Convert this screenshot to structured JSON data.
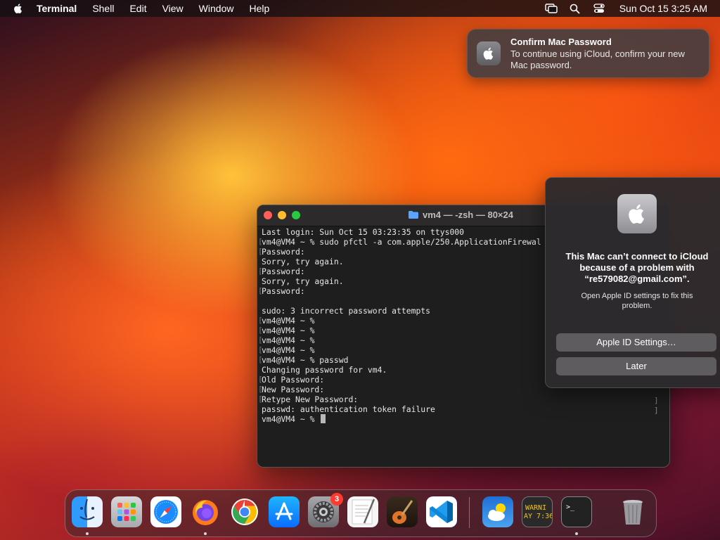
{
  "menubar": {
    "app_name": "Terminal",
    "items": [
      "Shell",
      "Edit",
      "View",
      "Window",
      "Help"
    ],
    "clock": "Sun Oct 15  3:25 AM"
  },
  "notification": {
    "title": "Confirm Mac Password",
    "body": "To continue using iCloud, confirm your new Mac password."
  },
  "terminal": {
    "title": "vm4 — -zsh — 80×24",
    "lines": [
      "Last login: Sun Oct 15 03:23:35 on ttys000",
      "vm4@VM4 ~ % sudo pfctl -a com.apple/250.ApplicationFirewal",
      "Password:",
      "Sorry, try again.",
      "Password:",
      "Sorry, try again.",
      "Password:",
      "",
      "sudo: 3 incorrect password attempts",
      "vm4@VM4 ~ %",
      "vm4@VM4 ~ %",
      "vm4@VM4 ~ %",
      "vm4@VM4 ~ %",
      "vm4@VM4 ~ % passwd",
      "Changing password for vm4.",
      "Old Password:",
      "New Password:",
      "Retype New Password:",
      "passwd: authentication token failure",
      "vm4@VM4 ~ % "
    ]
  },
  "alert": {
    "title": "This Mac can’t connect to iCloud because of a problem with “re579082@gmail.com”.",
    "body": "Open Apple ID settings to fix this problem.",
    "primary_button": "Apple ID Settings…",
    "secondary_button": "Later"
  },
  "dock": {
    "apps": [
      "finder-icon",
      "launchpad-icon",
      "safari-icon",
      "firefox-icon",
      "chrome-icon",
      "app-store-icon",
      "system-settings-icon",
      "textedit-icon",
      "garageband-icon",
      "vscode-icon",
      "weather-icon",
      "console-icon",
      "terminal-icon",
      "trash-icon"
    ],
    "settings_badge": "3",
    "console_text": [
      "WARNI",
      "AY 7:36"
    ],
    "terminal_prompt": ">_"
  },
  "colors": {
    "red": "#ff5f57",
    "yellow": "#febc2e",
    "green": "#28c840",
    "badge": "#ff3b30"
  }
}
